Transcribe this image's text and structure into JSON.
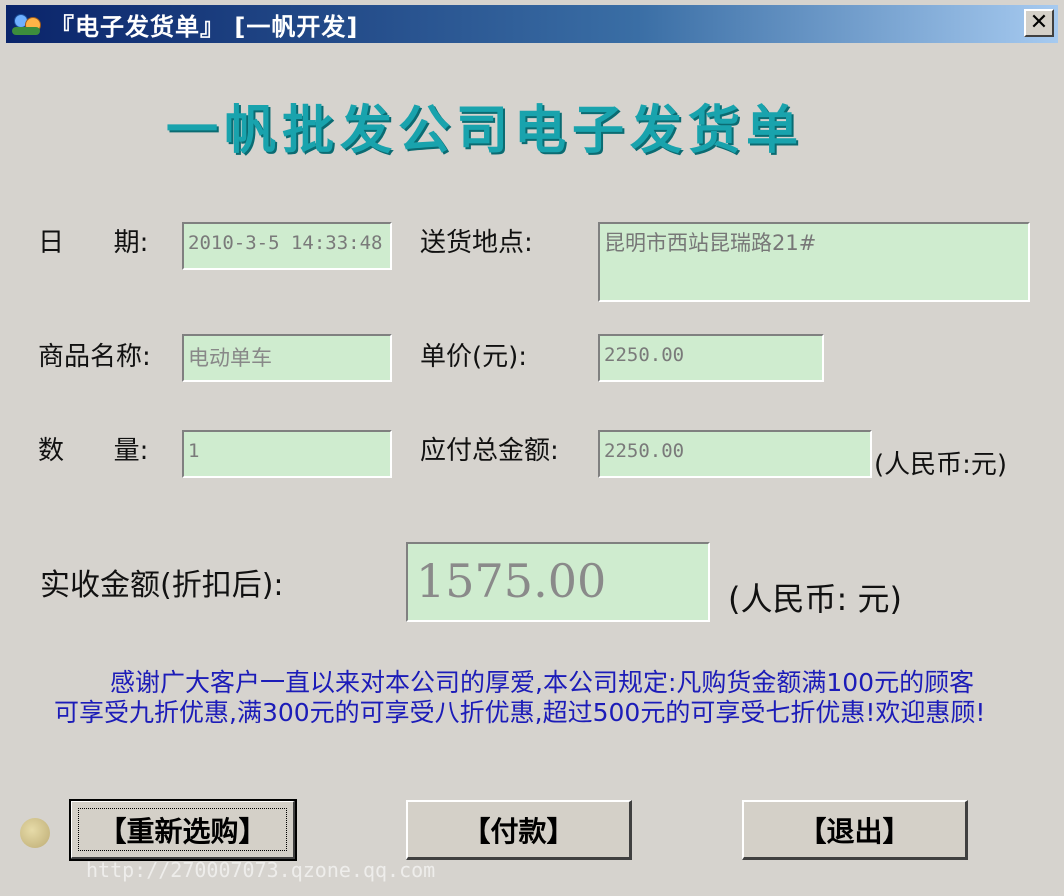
{
  "window": {
    "title": "『电子发货单』 [一帆开发]",
    "close_glyph": "✕"
  },
  "heading": "一帆批发公司电子发货单",
  "form": {
    "date_label": "日      期:",
    "date_value": "2010-3-5 14:33:48",
    "address_label": "送货地点:",
    "address_value": "昆明市西站昆瑞路21#",
    "product_label": "商品名称:",
    "product_value": "电动单车",
    "price_label": "单价(元):",
    "price_value": "2250.00",
    "qty_label": "数      量:",
    "qty_value": "1",
    "total_label": "应付总金额:",
    "total_value": "2250.00",
    "total_unit": "(人民币:元)",
    "received_label": "实收金额(折扣后):",
    "received_value": "1575.00",
    "received_unit": "(人民币: 元)"
  },
  "notice": "感谢广大客户一直以来对本公司的厚爱,本公司规定:凡购货金额满100元的顾客可享受九折优惠,满300元的可享受八折优惠,超过500元的可享受七折优惠!欢迎惠顾!",
  "buttons": {
    "reselect": "【重新选购】",
    "pay": "【付款】",
    "exit": "【退出】"
  },
  "watermark": "http://270007073.qzone.qq.com"
}
